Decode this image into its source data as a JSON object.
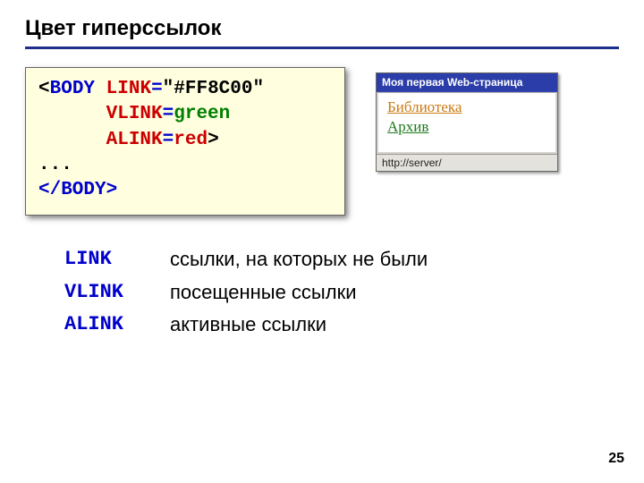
{
  "title": "Цвет гиперссылок",
  "code": {
    "lt": "<",
    "gt": ">",
    "body_open": "BODY",
    "link_attr": "LINK",
    "link_eq": "=",
    "link_val": "\"#FF8C00\"",
    "vlink_attr": "VLINK",
    "vlink_eq": "=",
    "vlink_val": "green",
    "alink_attr": "ALINK",
    "alink_eq": "=",
    "alink_val": "red",
    "ellipsis": "...",
    "body_close": "</BODY>"
  },
  "browser": {
    "title": "Моя первая Web-страница",
    "link1": "Библиотека",
    "link2": "Архив",
    "status": "http://server/"
  },
  "defs": [
    {
      "term": "LINK",
      "desc": "ссылки, на которых не были"
    },
    {
      "term": "VLINK",
      "desc": "посещенные ссылки"
    },
    {
      "term": "ALINK",
      "desc": "активные ссылки"
    }
  ],
  "page_number": "25"
}
